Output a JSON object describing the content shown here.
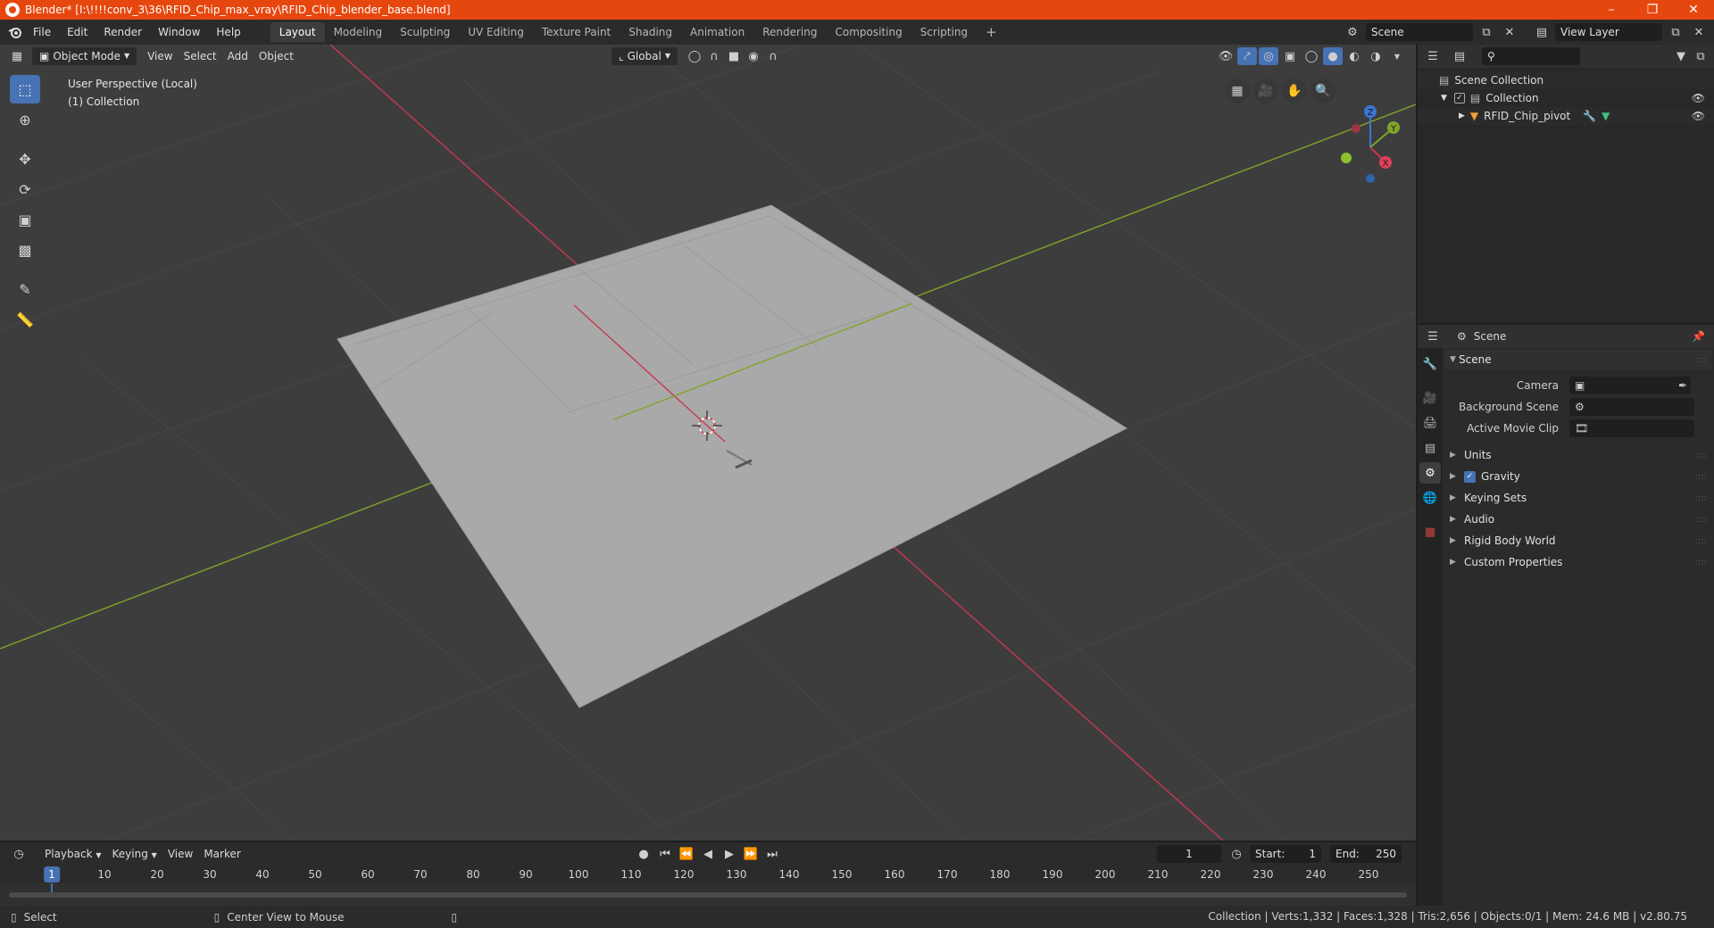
{
  "window": {
    "title": "Blender* [I:\\!!!!conv_3\\36\\RFID_Chip_max_vray\\RFID_Chip_blender_base.blend]",
    "minimize": "–",
    "maximize": "❐",
    "close": "✕"
  },
  "topbar": {
    "menus": [
      "File",
      "Edit",
      "Render",
      "Window",
      "Help"
    ],
    "workspaces": [
      "Layout",
      "Modeling",
      "Sculpting",
      "UV Editing",
      "Texture Paint",
      "Shading",
      "Animation",
      "Rendering",
      "Compositing",
      "Scripting"
    ],
    "active_workspace": "Layout",
    "add_tab": "+",
    "scene": "Scene",
    "view_layer": "View Layer"
  },
  "viewport": {
    "mode": "Object Mode",
    "menus": [
      "View",
      "Select",
      "Add",
      "Object"
    ],
    "transform_orientation": "Global",
    "perspective": "User Perspective (Local)",
    "collection": "(1) Collection",
    "gizmo_labels": {
      "x": "X",
      "y": "Y",
      "z": "Z"
    },
    "colors": {
      "background": "#3d3d3d",
      "plane": "#a8a8a8",
      "x_axis": "#c5394f",
      "y_axis": "#7ea52a",
      "grid": "#4a4a4a"
    }
  },
  "tools": [
    {
      "name": "select-box-icon",
      "active": true
    },
    {
      "name": "cursor-icon",
      "active": false
    },
    {
      "name": "move-icon",
      "active": false
    },
    {
      "name": "rotate-icon",
      "active": false
    },
    {
      "name": "scale-icon",
      "active": false
    },
    {
      "name": "transform-icon",
      "active": false
    },
    {
      "name": "annotate-icon",
      "active": false
    },
    {
      "name": "measure-icon",
      "active": false
    }
  ],
  "outliner": {
    "rows": [
      {
        "label": "Scene Collection",
        "indent": 0
      },
      {
        "label": "Collection",
        "indent": 1
      },
      {
        "label": "RFID_Chip_pivot",
        "indent": 2
      }
    ]
  },
  "properties": {
    "header": "Scene",
    "panel": "Scene",
    "fields": [
      {
        "label": "Camera",
        "value": ""
      },
      {
        "label": "Background Scene",
        "value": ""
      },
      {
        "label": "Active Movie Clip",
        "value": ""
      }
    ],
    "subpanels": [
      "Units",
      "Gravity",
      "Keying Sets",
      "Audio",
      "Rigid Body World",
      "Custom Properties"
    ],
    "gravity_checked": true
  },
  "timeline": {
    "menus": [
      "Playback",
      "Keying",
      "View",
      "Marker"
    ],
    "current_frame": "1",
    "start_label": "Start:",
    "start": "1",
    "end_label": "End:",
    "end": "250",
    "ruler": [
      "1",
      "10",
      "20",
      "30",
      "40",
      "50",
      "60",
      "70",
      "80",
      "90",
      "100",
      "110",
      "120",
      "130",
      "140",
      "150",
      "160",
      "170",
      "180",
      "190",
      "200",
      "210",
      "220",
      "230",
      "240",
      "250"
    ]
  },
  "statusbar": {
    "select": "Select",
    "center_view": "Center View to Mouse",
    "stats": "Collection | Verts:1,332 | Faces:1,328 | Tris:2,656 | Objects:0/1 | Mem: 24.6 MB | v2.80.75"
  }
}
